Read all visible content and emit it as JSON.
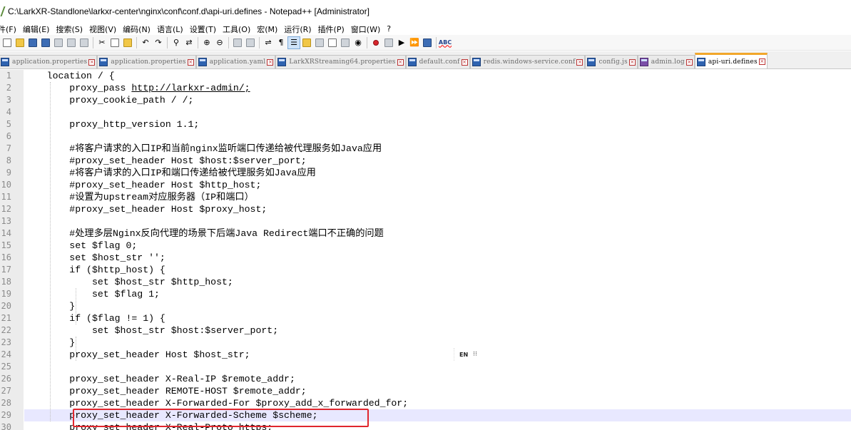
{
  "window": {
    "title": "C:\\LarkXR-Standlone\\larkxr-center\\nginx\\conf\\conf.d\\api-uri.defines - Notepad++ [Administrator]"
  },
  "menu": {
    "items": [
      "件(F)",
      "编辑(E)",
      "搜索(S)",
      "视图(V)",
      "编码(N)",
      "语言(L)",
      "设置(T)",
      "工具(O)",
      "宏(M)",
      "运行(R)",
      "插件(P)",
      "窗口(W)",
      "?"
    ]
  },
  "toolbar": {
    "buttons": [
      {
        "name": "new-file-icon",
        "style": "sq-white"
      },
      {
        "name": "open-file-icon",
        "style": "sq-yellow"
      },
      {
        "name": "save-icon",
        "style": "sq-blue"
      },
      {
        "name": "save-all-icon",
        "style": "sq-blue"
      },
      {
        "name": "close-icon",
        "style": "sq-gray"
      },
      {
        "name": "close-all-icon",
        "style": "sq-gray"
      },
      {
        "name": "print-icon",
        "style": "sq-gray"
      },
      {
        "name": "sep"
      },
      {
        "name": "cut-icon",
        "glyph": "✂"
      },
      {
        "name": "copy-icon",
        "style": "sq-white"
      },
      {
        "name": "paste-icon",
        "style": "sq-yellow"
      },
      {
        "name": "sep"
      },
      {
        "name": "undo-icon",
        "glyph": "↶"
      },
      {
        "name": "redo-icon",
        "glyph": "↷"
      },
      {
        "name": "sep"
      },
      {
        "name": "find-icon",
        "glyph": "⚲"
      },
      {
        "name": "replace-icon",
        "glyph": "⇄"
      },
      {
        "name": "sep"
      },
      {
        "name": "zoom-in-icon",
        "glyph": "⊕"
      },
      {
        "name": "zoom-out-icon",
        "glyph": "⊖"
      },
      {
        "name": "sep"
      },
      {
        "name": "sync-vertical-icon",
        "style": "sq-gray"
      },
      {
        "name": "sync-horizontal-icon",
        "style": "sq-gray"
      },
      {
        "name": "sep"
      },
      {
        "name": "word-wrap-icon",
        "glyph": "⇌"
      },
      {
        "name": "show-all-chars-icon",
        "glyph": "¶"
      },
      {
        "name": "indent-guide-icon",
        "glyph": "☰",
        "active": true
      },
      {
        "name": "user-lang-icon",
        "style": "sq-yellow"
      },
      {
        "name": "doc-map-icon",
        "style": "sq-gray"
      },
      {
        "name": "function-list-icon",
        "style": "sq-white"
      },
      {
        "name": "folder-workspace-icon",
        "style": "sq-gray"
      },
      {
        "name": "monitor-icon",
        "glyph": "◉"
      },
      {
        "name": "sep"
      },
      {
        "name": "record-macro-icon",
        "style": "sq-red"
      },
      {
        "name": "stop-macro-icon",
        "style": "sq-gray"
      },
      {
        "name": "play-macro-icon",
        "glyph": "▶"
      },
      {
        "name": "play-multiple-icon",
        "glyph": "⏩"
      },
      {
        "name": "save-macro-icon",
        "style": "sq-blue"
      },
      {
        "name": "sep"
      },
      {
        "name": "spell-check-icon",
        "glyph": "ABC",
        "abc": true
      }
    ]
  },
  "tabs": [
    {
      "label": "application.properties",
      "active": false,
      "icon": "blue"
    },
    {
      "label": "application.properties",
      "active": false,
      "icon": "blue"
    },
    {
      "label": "application.yaml",
      "active": false,
      "icon": "blue"
    },
    {
      "label": "LarkXRStreaming64.properties",
      "active": false,
      "icon": "blue"
    },
    {
      "label": "default.conf",
      "active": false,
      "icon": "blue"
    },
    {
      "label": "redis.windows-service.conf",
      "active": false,
      "icon": "blue"
    },
    {
      "label": "config.js",
      "active": false,
      "icon": "blue"
    },
    {
      "label": "admin.log",
      "active": false,
      "icon": "purple"
    },
    {
      "label": "api-uri.defines",
      "active": true,
      "icon": "blue"
    }
  ],
  "tab_close_glyph": "×",
  "editor": {
    "lines": [
      {
        "n": "1",
        "text": "    location / {"
      },
      {
        "n": "2",
        "text": "        proxy_pass ",
        "link": "http://larkxr-admin/;"
      },
      {
        "n": "3",
        "text": "        proxy_cookie_path / /;"
      },
      {
        "n": "4",
        "text": ""
      },
      {
        "n": "5",
        "text": "        proxy_http_version 1.1;"
      },
      {
        "n": "6",
        "text": ""
      },
      {
        "n": "7",
        "text": "        #将客户请求的入口IP和当前nginx监听端口传递给被代理服务如Java应用"
      },
      {
        "n": "8",
        "text": "        #proxy_set_header Host $host:$server_port;"
      },
      {
        "n": "9",
        "text": "        #将客户请求的入口IP和端口传递给被代理服务如Java应用"
      },
      {
        "n": "10",
        "text": "        #proxy_set_header Host $http_host;"
      },
      {
        "n": "11",
        "text": "        #设置为upstream对应服务器（IP和端口）"
      },
      {
        "n": "12",
        "text": "        #proxy_set_header Host $proxy_host;"
      },
      {
        "n": "13",
        "text": ""
      },
      {
        "n": "14",
        "text": "        #处理多层Nginx反向代理的场景下后端Java Redirect端口不正确的问题"
      },
      {
        "n": "15",
        "text": "        set $flag 0;"
      },
      {
        "n": "16",
        "text": "        set $host_str '';"
      },
      {
        "n": "17",
        "text": "        if ($http_host) {"
      },
      {
        "n": "18",
        "text": "            set $host_str $http_host;"
      },
      {
        "n": "19",
        "text": "            set $flag 1;"
      },
      {
        "n": "20",
        "text": "        }"
      },
      {
        "n": "21",
        "text": "        if ($flag != 1) {"
      },
      {
        "n": "22",
        "text": "            set $host_str $host:$server_port;"
      },
      {
        "n": "23",
        "text": "        }"
      },
      {
        "n": "24",
        "text": "        proxy_set_header Host $host_str;"
      },
      {
        "n": "25",
        "text": ""
      },
      {
        "n": "26",
        "text": "        proxy_set_header X-Real-IP $remote_addr;"
      },
      {
        "n": "27",
        "text": "        proxy_set_header REMOTE-HOST $remote_addr;"
      },
      {
        "n": "28",
        "text": "        proxy_set_header X-Forwarded-For $proxy_add_x_forwarded_for;"
      },
      {
        "n": "29",
        "text": "        proxy_set_header X-Forwarded-Scheme $scheme;",
        "current": true
      },
      {
        "n": "30",
        "text": "        proxy_set_header X-Real-Proto https;"
      }
    ]
  },
  "ime": {
    "text": "EN",
    "icon_glyph": "⁝⁝"
  },
  "colors": {
    "highlight_border": "#e0262d",
    "active_tab_accent": "#f2a72b",
    "current_line_bg": "#e8e8ff"
  }
}
